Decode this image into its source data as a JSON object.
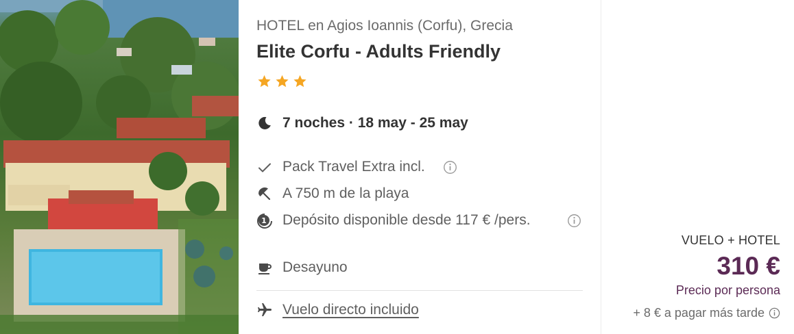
{
  "hotel": {
    "photo_alt": "Elite Corfu hotel aerial view",
    "location": "HOTEL en Agios Ioannis (Corfu), Grecia",
    "name": "Elite Corfu - Adults Friendly",
    "stars": 3,
    "star_color": "#f5a623"
  },
  "stay": {
    "dates": "7 noches · 18 may - 25 may",
    "icon": "moon-icon"
  },
  "features": [
    {
      "icon": "checkmark-icon",
      "text": "Pack Travel Extra incl.",
      "has_info": true
    },
    {
      "icon": "beach-umbrella-icon",
      "text": "A 750 m de la playa",
      "has_info": false
    },
    {
      "icon": "deposit-coin-icon",
      "text": "Depósito disponible desde 117 € /pers.",
      "has_info": true
    },
    {
      "icon": "coffee-cup-icon",
      "text": "Desayuno",
      "has_info": false
    }
  ],
  "flight": {
    "icon": "airplane-icon",
    "link_text": "Vuelo directo incluido"
  },
  "price": {
    "package_label": "VUELO + HOTEL",
    "amount": "310 €",
    "per_person": "Precio por persona",
    "extra": "+ 8 € a pagar más tarde",
    "price_color": "#5b2a55"
  }
}
